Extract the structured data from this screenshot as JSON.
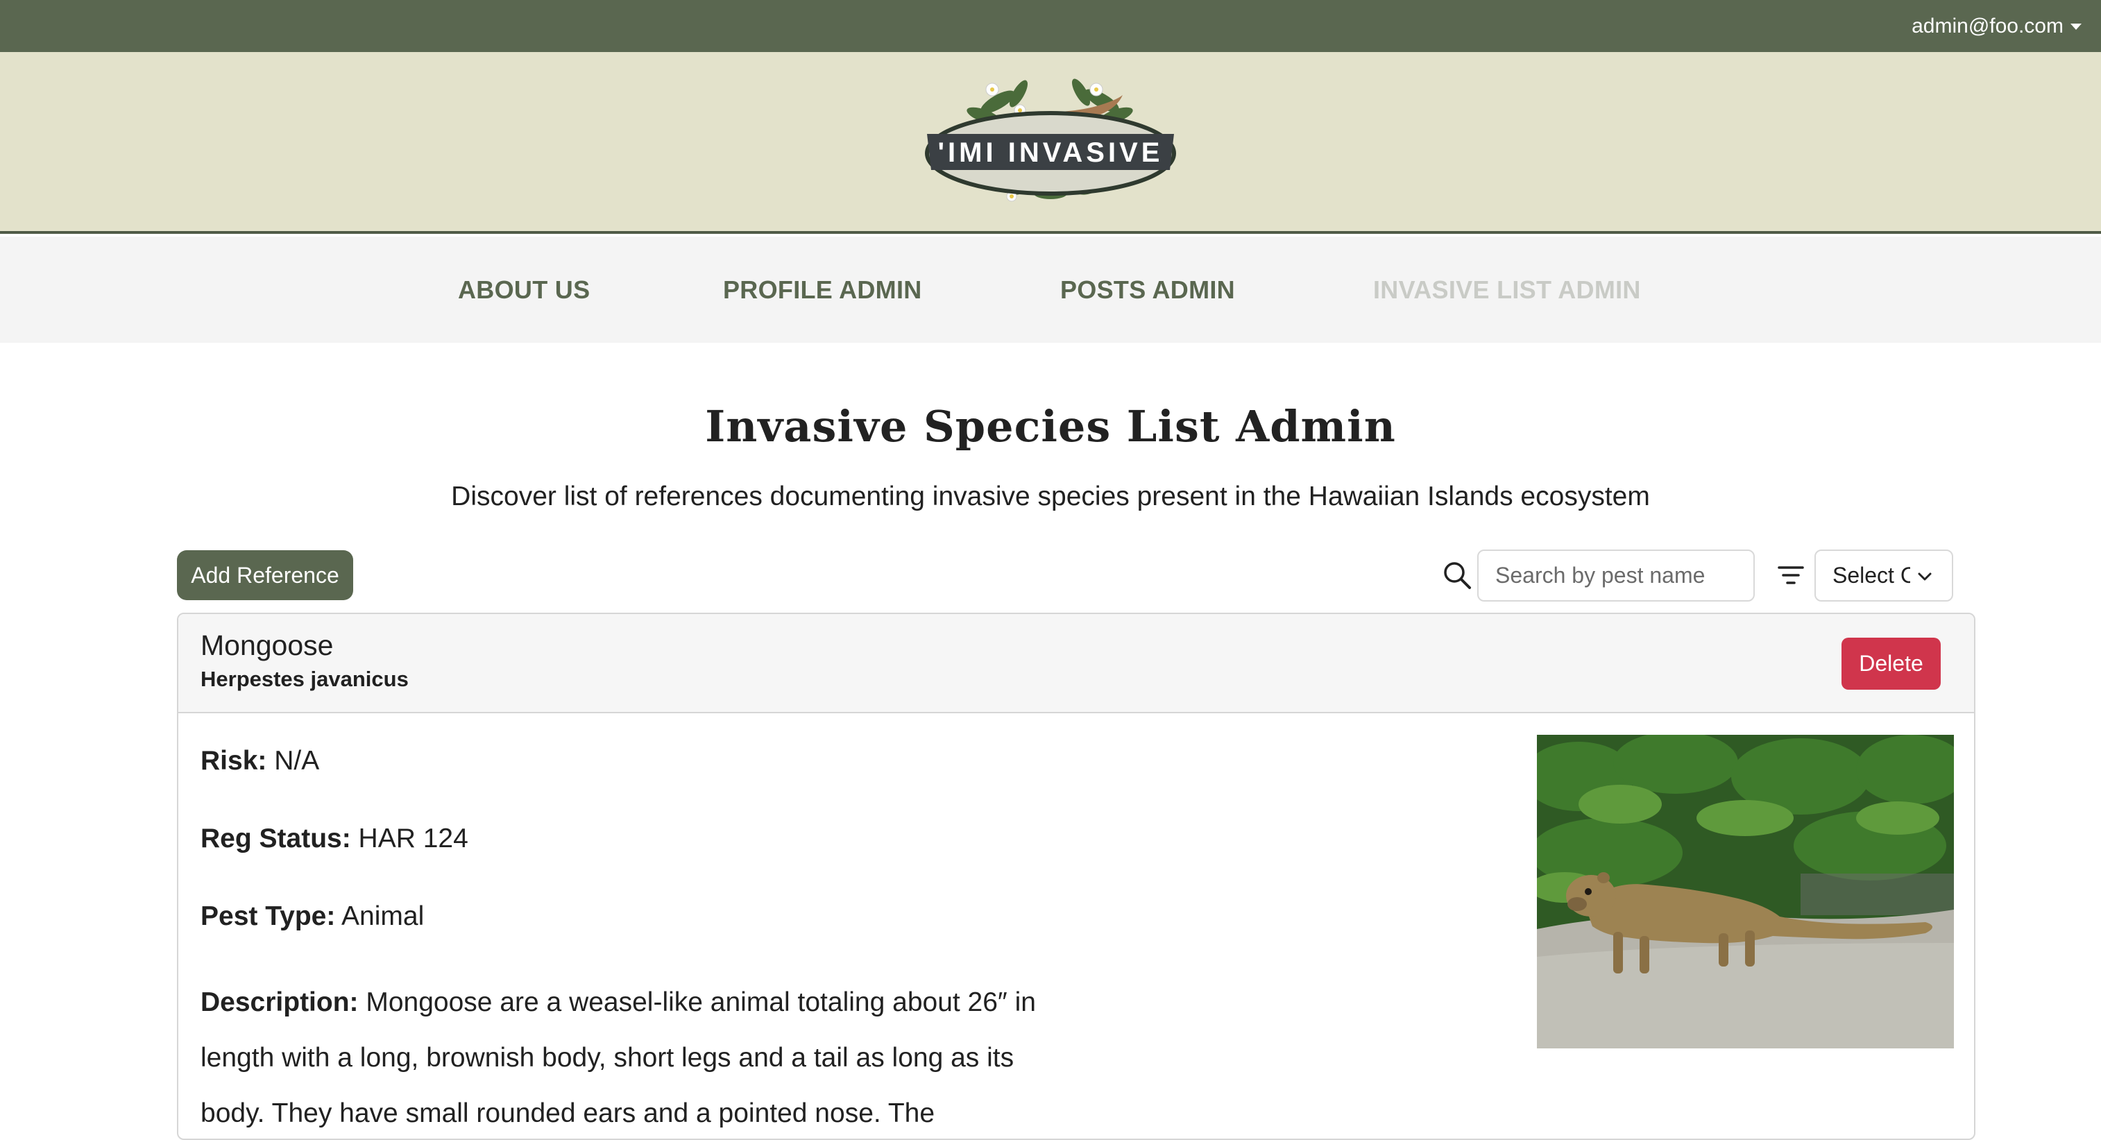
{
  "header": {
    "user_email": "admin@foo.com",
    "logo_text": "'IMI INVASIVE"
  },
  "nav": {
    "items": [
      {
        "label": "ABOUT US"
      },
      {
        "label": "PROFILE ADMIN"
      },
      {
        "label": "POSTS ADMIN"
      },
      {
        "label": "INVASIVE LIST ADMIN"
      }
    ],
    "active_index": 3
  },
  "page": {
    "title": "Invasive Species List Admin",
    "subtitle": "Discover list of references documenting invasive species present in the Hawaiian Islands ecosystem"
  },
  "toolbar": {
    "add_label": "Add Reference",
    "search_placeholder": "Search by pest name",
    "search_value": "",
    "select_label": "Select Category"
  },
  "card": {
    "common_name": "Mongoose",
    "scientific_name": "Herpestes javanicus",
    "delete_label": "Delete",
    "risk_label": "Risk:",
    "risk_value": "N/A",
    "reg_label": "Reg Status:",
    "reg_value": "HAR 124",
    "pest_type_label": "Pest Type:",
    "pest_type_value": "Animal",
    "description_label": "Description:",
    "description_value": "Mongoose are a weasel-like animal totaling about 26″ in length with a long, brownish body, short legs and a tail as long as its body. They have small rounded ears and a pointed nose. The",
    "image": "mongoose-photo"
  },
  "colors": {
    "topbar": "#5a6750",
    "banner": "#e3e2cb",
    "nav_bg": "#f4f4f4",
    "nav_text": "#5a6750",
    "nav_active": "#c9cbc6",
    "primary_button": "#5a6750",
    "danger_button": "#d0354c"
  }
}
